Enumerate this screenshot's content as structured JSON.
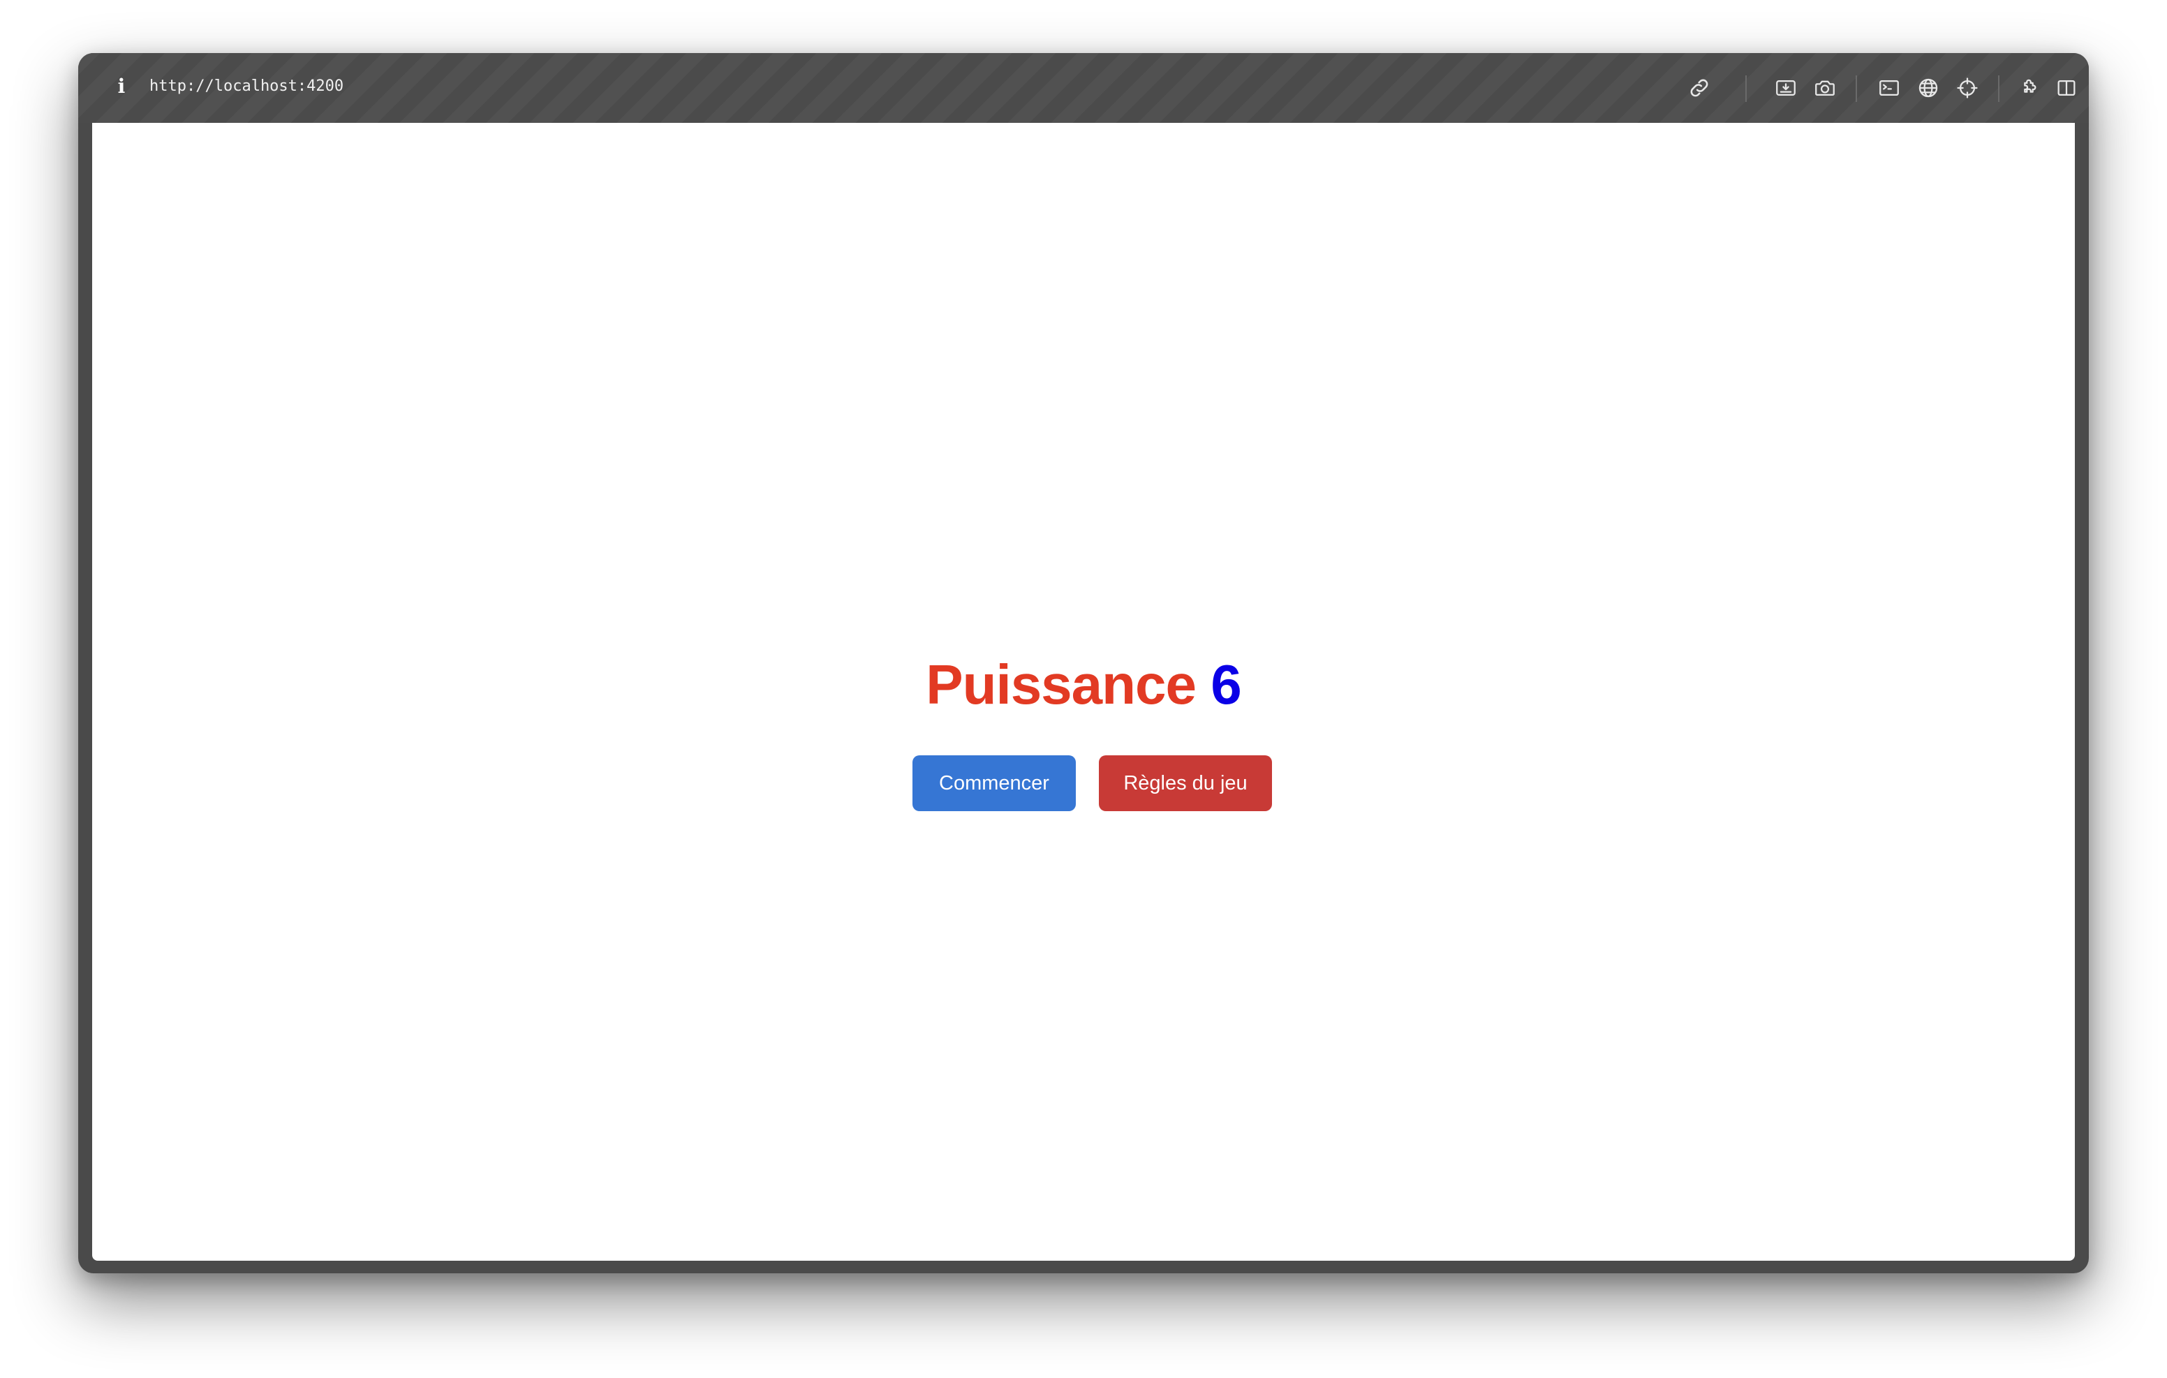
{
  "browser": {
    "url": "http://localhost:4200",
    "icons": {
      "info": "info-icon",
      "link": "link-icon",
      "screen_capture": "screen-capture-icon",
      "camera": "camera-icon",
      "terminal": "terminal-icon",
      "globe": "globe-icon",
      "crosshair": "crosshair-icon",
      "extensions": "puzzle-icon",
      "sidebar": "sidebar-toggle-icon"
    },
    "info_glyph": "i"
  },
  "page": {
    "title_word": "Puissance",
    "title_number": "6",
    "title_word_color": "#e23a23",
    "title_number_color": "#0a00e6",
    "buttons": {
      "start_label": "Commencer",
      "rules_label": "Règles du jeu",
      "start_color": "#3676d4",
      "rules_color": "#c83a36"
    }
  }
}
